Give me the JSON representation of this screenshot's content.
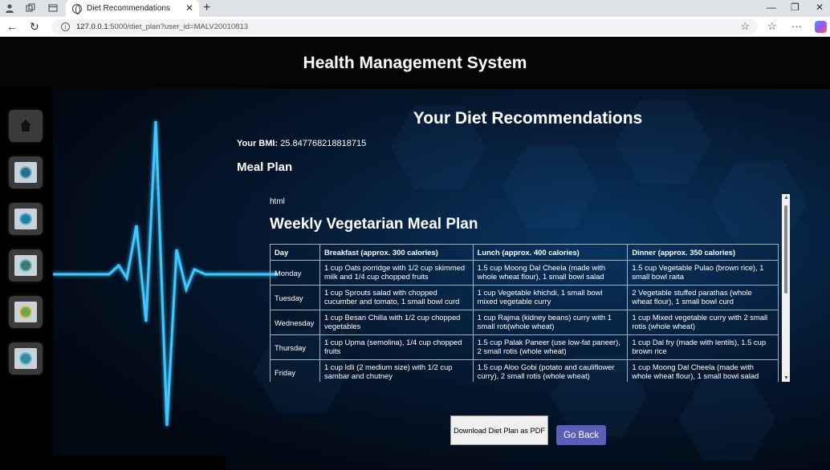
{
  "browser": {
    "tab_title": "Diet Recommendations",
    "url_host": "127.0.0.1",
    "url_path": ":5000/diet_plan?user_id=MALV20010813"
  },
  "site": {
    "title": "Health Management System"
  },
  "sidebar": {
    "items": [
      "home-icon",
      "clinic-icon",
      "medical-icon",
      "health-icon",
      "nutrition-icon",
      "planner-icon"
    ]
  },
  "main": {
    "heading": "Your Diet Recommendations",
    "bmi_label": "Your BMI:",
    "bmi_value": "25.847768218818715",
    "meal_plan_heading": "Meal Plan",
    "frame_html_text": "html",
    "frame_title": "Weekly Vegetarian Meal Plan",
    "table": {
      "headers": [
        "Day",
        "Breakfast (approx. 300 calories)",
        "Lunch (approx. 400 calories)",
        "Dinner (approx. 350 calories)"
      ],
      "rows": [
        [
          "Monday",
          "1 cup Oats porridge with 1/2 cup skimmed milk and 1/4 cup chopped fruits",
          "1.5 cup Moong Dal Cheela (made with whole wheat flour), 1 small bowl salad",
          "1.5 cup Vegetable Pulao (brown rice), 1 small bowl raita"
        ],
        [
          "Tuesday",
          "1 cup Sprouts salad with chopped cucumber and tomato, 1 small bowl curd",
          "1 cup Vegetable khichdi, 1 small bowl mixed vegetable curry",
          "2 Vegetable stuffed parathas (whole wheat flour), 1 small bowl curd"
        ],
        [
          "Wednesday",
          "1 cup Besan Chilla with 1/2 cup chopped vegetables",
          "1 cup Rajma (kidney beans) curry with 1 small roti(whole wheat)",
          "1 cup Mixed vegetable curry with 2 small rotis (whole wheat)"
        ],
        [
          "Thursday",
          "1 cup Upma (semolina), 1/4 cup chopped fruits",
          "1.5 cup Palak Paneer (use low-fat paneer), 2 small rotis (whole wheat)",
          "1 cup Dal fry (made with lentils), 1.5 cup brown rice"
        ],
        [
          "Friday",
          "1 cup Idli (2 medium size) with 1/2 cup sambar and chutney",
          "1.5 cup Aloo Gobi (potato and cauliflower curry), 2 small rotis (whole wheat)",
          "1 cup Moong Dal Cheela (made with whole wheat flour), 1 small bowl salad"
        ]
      ]
    },
    "download_button": "Download Diet Plan as PDF",
    "back_button": "Go Back"
  }
}
